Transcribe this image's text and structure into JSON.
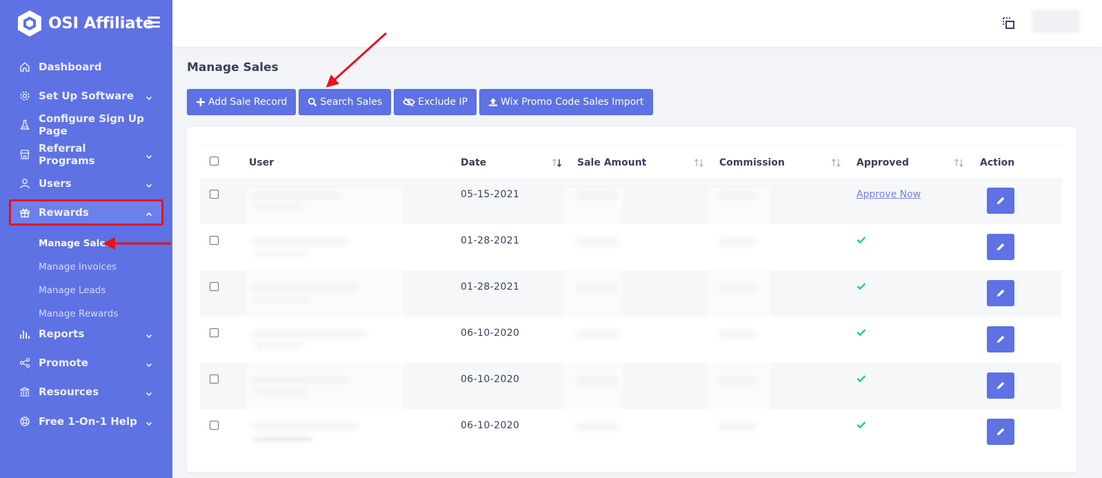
{
  "brand": {
    "name": "OSI Affiliate"
  },
  "sidebar": {
    "items": [
      {
        "label": "Dashboard",
        "icon": "home-icon",
        "has_chevron": false
      },
      {
        "label": "Set Up Software",
        "icon": "gear-icon",
        "has_chevron": true
      },
      {
        "label": "Configure Sign Up Page",
        "icon": "flask-icon",
        "has_chevron": false
      },
      {
        "label": "Referral Programs",
        "icon": "store-icon",
        "has_chevron": true
      },
      {
        "label": "Users",
        "icon": "user-icon",
        "has_chevron": true
      },
      {
        "label": "Rewards",
        "icon": "gift-icon",
        "has_chevron": true,
        "expanded": true
      },
      {
        "label": "Reports",
        "icon": "bar-chart-icon",
        "has_chevron": true
      },
      {
        "label": "Promote",
        "icon": "share-icon",
        "has_chevron": true
      },
      {
        "label": "Resources",
        "icon": "bank-icon",
        "has_chevron": true
      },
      {
        "label": "Free 1-On-1 Help",
        "icon": "lifebuoy-icon",
        "has_chevron": true
      }
    ],
    "rewards_sub": [
      {
        "label": "Manage Sales",
        "current": true
      },
      {
        "label": "Manage Invoices"
      },
      {
        "label": "Manage Leads"
      },
      {
        "label": "Manage Rewards"
      }
    ]
  },
  "page": {
    "title": "Manage Sales"
  },
  "toolbar": {
    "add_sale": "Add Sale Record",
    "search_sales": "Search Sales",
    "exclude_ip": "Exclude IP",
    "wix_import": "Wix Promo Code Sales Import"
  },
  "table": {
    "columns": [
      "User",
      "Date",
      "Sale Amount",
      "Commission",
      "Approved",
      "Action"
    ],
    "rows": [
      {
        "date": "05-15-2021",
        "approved": "Approve Now",
        "is_approved": false
      },
      {
        "date": "01-28-2021",
        "approved": "",
        "is_approved": true
      },
      {
        "date": "01-28-2021",
        "approved": "",
        "is_approved": true
      },
      {
        "date": "06-10-2020",
        "approved": "",
        "is_approved": true
      },
      {
        "date": "06-10-2020",
        "approved": "",
        "is_approved": true
      },
      {
        "date": "06-10-2020",
        "approved": "",
        "is_approved": true
      }
    ]
  },
  "colors": {
    "sidebar": "#5e72e4",
    "accent": "#5e72e4",
    "highlight": "#e8101d",
    "check": "#2dce89"
  }
}
